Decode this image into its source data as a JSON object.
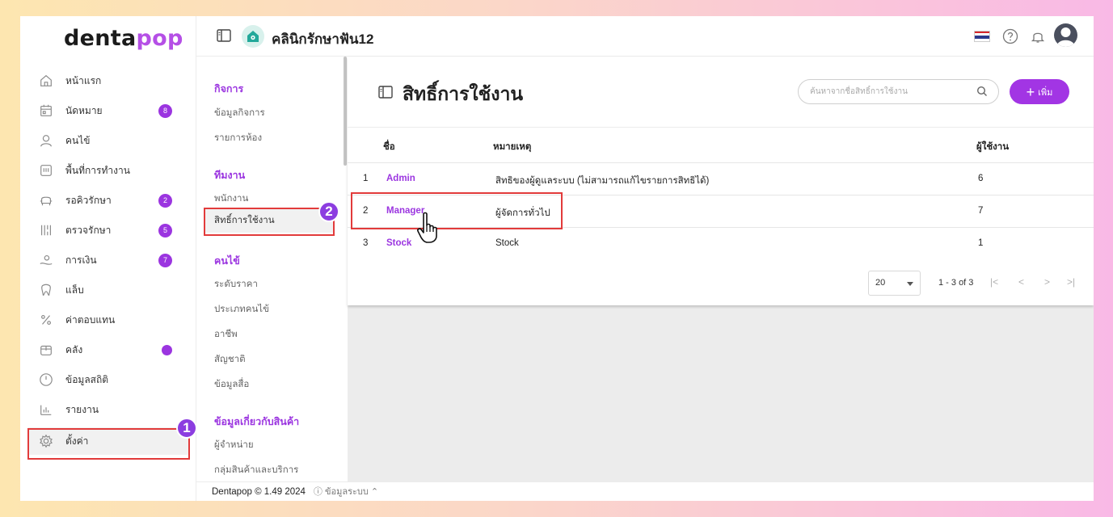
{
  "app": {
    "logo_main": "denta",
    "logo_accent": "pop"
  },
  "header": {
    "clinic_name": "คลินิกรักษาฟัน12"
  },
  "sidebar": {
    "items": [
      {
        "label": "หน้าแรก",
        "icon": "home-icon"
      },
      {
        "label": "นัดหมาย",
        "icon": "calendar-icon",
        "badge": "8"
      },
      {
        "label": "คนไข้",
        "icon": "user-icon"
      },
      {
        "label": "พื้นที่การทำงาน",
        "icon": "workspace-icon"
      },
      {
        "label": "รอคิวรักษา",
        "icon": "chair-icon",
        "badge": "2"
      },
      {
        "label": "ตรวจรักษา",
        "icon": "tools-icon",
        "badge": "5"
      },
      {
        "label": "การเงิน",
        "icon": "money-icon",
        "badge": "7"
      },
      {
        "label": "แล็บ",
        "icon": "tooth-icon"
      },
      {
        "label": "ค่าตอบแทน",
        "icon": "percent-icon"
      },
      {
        "label": "คลัง",
        "icon": "box-icon",
        "dot": true
      },
      {
        "label": "ข้อมูลสถิติ",
        "icon": "gauge-icon"
      },
      {
        "label": "รายงาน",
        "icon": "report-icon"
      },
      {
        "label": "ตั้งค่า",
        "icon": "gear-icon"
      }
    ]
  },
  "submenu": {
    "sections": [
      {
        "title": "กิจการ",
        "items": [
          "ข้อมูลกิจการ",
          "รายการห้อง"
        ]
      },
      {
        "title": "ทีมงาน",
        "items": [
          "พนักงาน",
          "สิทธิ์การใช้งาน"
        ]
      },
      {
        "title": "คนไข้",
        "items": [
          "ระดับราคา",
          "ประเภทคนไข้",
          "อาชีพ",
          "สัญชาติ",
          "ข้อมูลสื่อ"
        ]
      },
      {
        "title": "ข้อมูลเกี่ยวกับสินค้า",
        "items": [
          "ผู้จำหน่าย",
          "กลุ่มสินค้าและบริการ"
        ]
      }
    ]
  },
  "main": {
    "title": "สิทธิ์การใช้งาน",
    "search_placeholder": "ค้นหาจากชื่อสิทธิ์การใช้งาน",
    "add_label": "เพิ่ม",
    "columns": {
      "name": "ชื่อ",
      "note": "หมายเหตุ",
      "users": "ผู้ใช้งาน"
    },
    "rows": [
      {
        "no": "1",
        "name": "Admin",
        "note": "สิทธิของผู้ดูแลระบบ (ไม่สามารถแก้ไขรายการสิทธิได้)",
        "users": "6"
      },
      {
        "no": "2",
        "name": "Manager",
        "note": "ผู้จัดการทั่วไป",
        "users": "7"
      },
      {
        "no": "3",
        "name": "Stock",
        "note": "Stock",
        "users": "1"
      }
    ],
    "pager": {
      "page_size": "20",
      "range": "1 - 3 of 3",
      "first": "|<",
      "prev": "<",
      "next": ">",
      "last": ">|"
    }
  },
  "footer": {
    "version": "Dentapop © 1.49 2024",
    "sysinfo": "ⓘ ข้อมูลระบบ ⌃"
  },
  "annotations": {
    "step1": "1",
    "step2": "2"
  },
  "colors": {
    "accent": "#9b35e0",
    "highlight": "#e23b3b"
  }
}
